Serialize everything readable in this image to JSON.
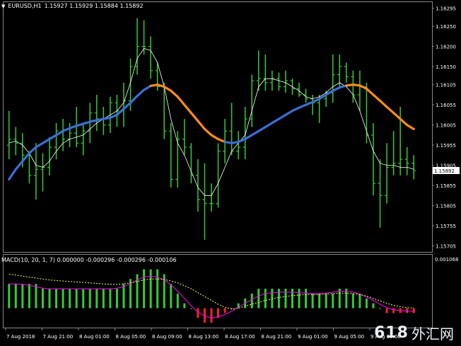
{
  "header": {
    "symbol": "EURUSD,H1",
    "ohlc": "1.15927 1.15929 1.15884 1.15892"
  },
  "price_axis": {
    "ticks": [
      "1.16295",
      "1.16250",
      "1.16200",
      "1.16150",
      "1.16105",
      "1.16055",
      "1.16005",
      "1.15955",
      "1.15905",
      "1.15855",
      "1.15805",
      "1.15755",
      "1.15705"
    ],
    "current_price": "1.15892"
  },
  "macd": {
    "label": "MACD(10, 20, 1, 7) 0.000000 -0.000296 -0.000296 -0.000106",
    "top_tick": "0.001068"
  },
  "time_axis": {
    "labels": [
      "7 Aug 2018",
      "7 Aug 21:00",
      "8 Aug 01:00",
      "8 Aug 05:00",
      "8 Aug 09:00",
      "8 Aug 13:00",
      "8 Aug 17:00",
      "8 Aug 21:00",
      "9 Aug 01:00",
      "9 Aug 05:00",
      "9 Aug 09:00"
    ]
  },
  "watermark": {
    "number": "618",
    "text": "外汇网"
  },
  "colors": {
    "bars": "#33cc33",
    "ma_up": "#3b6fd6",
    "ma_down": "#ff8c1a",
    "macd_signal": "#ff00ff",
    "macd_yellow": "#ffff66",
    "macd_neg": "#ff2222",
    "price_label_bg": "#ffffff"
  },
  "chart_data": {
    "type": "ohlc",
    "bars": [
      {
        "o": 1.15955,
        "h": 1.1604,
        "l": 1.1592,
        "c": 1.1597
      },
      {
        "o": 1.1597,
        "h": 1.16,
        "l": 1.1593,
        "c": 1.1596
      },
      {
        "o": 1.1596,
        "h": 1.15985,
        "l": 1.159,
        "c": 1.1593
      },
      {
        "o": 1.1593,
        "h": 1.1594,
        "l": 1.1586,
        "c": 1.1588
      },
      {
        "o": 1.1588,
        "h": 1.1596,
        "l": 1.1582,
        "c": 1.15895
      },
      {
        "o": 1.15895,
        "h": 1.15935,
        "l": 1.1584,
        "c": 1.159
      },
      {
        "o": 1.159,
        "h": 1.15975,
        "l": 1.1588,
        "c": 1.1595
      },
      {
        "o": 1.1595,
        "h": 1.1601,
        "l": 1.1592,
        "c": 1.1599
      },
      {
        "o": 1.1599,
        "h": 1.1602,
        "l": 1.1594,
        "c": 1.1597
      },
      {
        "o": 1.1597,
        "h": 1.1601,
        "l": 1.1595,
        "c": 1.15985
      },
      {
        "o": 1.15985,
        "h": 1.1605,
        "l": 1.1595,
        "c": 1.1596
      },
      {
        "o": 1.1596,
        "h": 1.1601,
        "l": 1.1593,
        "c": 1.1599
      },
      {
        "o": 1.1599,
        "h": 1.1606,
        "l": 1.1596,
        "c": 1.16035
      },
      {
        "o": 1.16035,
        "h": 1.1608,
        "l": 1.1599,
        "c": 1.1602
      },
      {
        "o": 1.1602,
        "h": 1.1605,
        "l": 1.1598,
        "c": 1.16005
      },
      {
        "o": 1.16005,
        "h": 1.16075,
        "l": 1.15985,
        "c": 1.1606
      },
      {
        "o": 1.1606,
        "h": 1.1608,
        "l": 1.16,
        "c": 1.1604
      },
      {
        "o": 1.1604,
        "h": 1.1611,
        "l": 1.16,
        "c": 1.16065
      },
      {
        "o": 1.16065,
        "h": 1.1617,
        "l": 1.1604,
        "c": 1.1615
      },
      {
        "o": 1.1615,
        "h": 1.1627,
        "l": 1.1613,
        "c": 1.162
      },
      {
        "o": 1.162,
        "h": 1.16265,
        "l": 1.1618,
        "c": 1.162
      },
      {
        "o": 1.162,
        "h": 1.16225,
        "l": 1.1612,
        "c": 1.1614
      },
      {
        "o": 1.1614,
        "h": 1.1616,
        "l": 1.1609,
        "c": 1.161
      },
      {
        "o": 1.161,
        "h": 1.1611,
        "l": 1.1597,
        "c": 1.1599
      },
      {
        "o": 1.1599,
        "h": 1.1601,
        "l": 1.1585,
        "c": 1.1587
      },
      {
        "o": 1.1587,
        "h": 1.1599,
        "l": 1.1585,
        "c": 1.1597
      },
      {
        "o": 1.1597,
        "h": 1.1602,
        "l": 1.1593,
        "c": 1.1595
      },
      {
        "o": 1.1595,
        "h": 1.1596,
        "l": 1.1586,
        "c": 1.1588
      },
      {
        "o": 1.1588,
        "h": 1.1592,
        "l": 1.1579,
        "c": 1.1582
      },
      {
        "o": 1.1582,
        "h": 1.1591,
        "l": 1.1572,
        "c": 1.1581
      },
      {
        "o": 1.1581,
        "h": 1.1586,
        "l": 1.1579,
        "c": 1.1581
      },
      {
        "o": 1.1581,
        "h": 1.1596,
        "l": 1.158,
        "c": 1.1594
      },
      {
        "o": 1.1594,
        "h": 1.1602,
        "l": 1.1591,
        "c": 1.1599
      },
      {
        "o": 1.1599,
        "h": 1.1606,
        "l": 1.1593,
        "c": 1.1594
      },
      {
        "o": 1.1594,
        "h": 1.1599,
        "l": 1.1592,
        "c": 1.1595
      },
      {
        "o": 1.1595,
        "h": 1.1605,
        "l": 1.1592,
        "c": 1.1602
      },
      {
        "o": 1.1602,
        "h": 1.1613,
        "l": 1.16,
        "c": 1.16115
      },
      {
        "o": 1.16115,
        "h": 1.1619,
        "l": 1.1609,
        "c": 1.1612
      },
      {
        "o": 1.1612,
        "h": 1.1618,
        "l": 1.1609,
        "c": 1.1611
      },
      {
        "o": 1.1611,
        "h": 1.1614,
        "l": 1.1609,
        "c": 1.1612
      },
      {
        "o": 1.1612,
        "h": 1.16135,
        "l": 1.1609,
        "c": 1.161
      },
      {
        "o": 1.161,
        "h": 1.1614,
        "l": 1.16085,
        "c": 1.16115
      },
      {
        "o": 1.16115,
        "h": 1.1612,
        "l": 1.1608,
        "c": 1.16095
      },
      {
        "o": 1.16095,
        "h": 1.1611,
        "l": 1.16075,
        "c": 1.1608
      },
      {
        "o": 1.1608,
        "h": 1.16095,
        "l": 1.1606,
        "c": 1.1607
      },
      {
        "o": 1.1607,
        "h": 1.1608,
        "l": 1.1603,
        "c": 1.1606
      },
      {
        "o": 1.1606,
        "h": 1.1608,
        "l": 1.1601,
        "c": 1.1607
      },
      {
        "o": 1.1607,
        "h": 1.1609,
        "l": 1.1605,
        "c": 1.16085
      },
      {
        "o": 1.16085,
        "h": 1.1618,
        "l": 1.1606,
        "c": 1.1613
      },
      {
        "o": 1.1613,
        "h": 1.1618,
        "l": 1.161,
        "c": 1.1615
      },
      {
        "o": 1.1615,
        "h": 1.1616,
        "l": 1.1611,
        "c": 1.16125
      },
      {
        "o": 1.16125,
        "h": 1.1614,
        "l": 1.1606,
        "c": 1.1608
      },
      {
        "o": 1.1608,
        "h": 1.1614,
        "l": 1.1604,
        "c": 1.161
      },
      {
        "o": 1.161,
        "h": 1.1611,
        "l": 1.1596,
        "c": 1.1598
      },
      {
        "o": 1.1598,
        "h": 1.1601,
        "l": 1.1583,
        "c": 1.1586
      },
      {
        "o": 1.1586,
        "h": 1.1592,
        "l": 1.1575,
        "c": 1.1583
      },
      {
        "o": 1.1583,
        "h": 1.1596,
        "l": 1.1581,
        "c": 1.159
      },
      {
        "o": 1.159,
        "h": 1.1599,
        "l": 1.1588,
        "c": 1.1591
      },
      {
        "o": 1.1591,
        "h": 1.1605,
        "l": 1.1588,
        "c": 1.1592
      },
      {
        "o": 1.1592,
        "h": 1.1595,
        "l": 1.1588,
        "c": 1.1591
      },
      {
        "o": 1.1591,
        "h": 1.1593,
        "l": 1.1587,
        "c": 1.15892
      }
    ],
    "thin_ma": [
      1.1596,
      1.15965,
      1.15955,
      1.15935,
      1.15905,
      1.159,
      1.15915,
      1.1594,
      1.1596,
      1.1597,
      1.15975,
      1.1598,
      1.15995,
      1.1601,
      1.1602,
      1.1603,
      1.1604,
      1.1606,
      1.1611,
      1.1617,
      1.16195,
      1.1619,
      1.1616,
      1.161,
      1.1602,
      1.1596,
      1.1593,
      1.1589,
      1.1585,
      1.1583,
      1.1583,
      1.1586,
      1.159,
      1.1594,
      1.1596,
      1.1598,
      1.1604,
      1.161,
      1.1612,
      1.1612,
      1.16115,
      1.1611,
      1.161,
      1.1609,
      1.16075,
      1.1607,
      1.16075,
      1.16085,
      1.161,
      1.1611,
      1.161,
      1.1608,
      1.1604,
      1.1599,
      1.1594,
      1.1591,
      1.15905,
      1.15905,
      1.159,
      1.159,
      1.15895
    ],
    "trend_ma": [
      1.1587,
      1.15895,
      1.15915,
      1.15935,
      1.1595,
      1.1596,
      1.1597,
      1.1598,
      1.1599,
      1.15997,
      1.16003,
      1.16008,
      1.16013,
      1.16017,
      1.1602,
      1.16023,
      1.1603,
      1.16045,
      1.1606,
      1.16077,
      1.16092,
      1.16102,
      1.16105,
      1.161,
      1.1609,
      1.16075,
      1.16055,
      1.16035,
      1.16015,
      1.15995,
      1.1598,
      1.1597,
      1.15963,
      1.1596,
      1.15963,
      1.1597,
      1.1598,
      1.1599,
      1.16,
      1.1601,
      1.1602,
      1.1603,
      1.1604,
      1.16048,
      1.16055,
      1.16062,
      1.1607,
      1.1608,
      1.1609,
      1.16098,
      1.16103,
      1.16105,
      1.16103,
      1.16095,
      1.1608,
      1.16065,
      1.1605,
      1.16035,
      1.1602,
      1.16005,
      1.15995
    ],
    "trend_dir": [
      "u",
      "u",
      "u",
      "u",
      "u",
      "u",
      "u",
      "u",
      "u",
      "u",
      "u",
      "u",
      "u",
      "u",
      "u",
      "u",
      "u",
      "u",
      "u",
      "u",
      "u",
      "u",
      "d",
      "d",
      "d",
      "d",
      "d",
      "d",
      "d",
      "d",
      "d",
      "d",
      "d",
      "u",
      "u",
      "u",
      "u",
      "u",
      "u",
      "u",
      "u",
      "u",
      "u",
      "u",
      "u",
      "u",
      "u",
      "u",
      "u",
      "u",
      "u",
      "d",
      "d",
      "d",
      "d",
      "d",
      "d",
      "d",
      "d",
      "d",
      "d"
    ],
    "macd_hist": [
      0.0005,
      0.0005,
      0.0005,
      0.0005,
      0.0005,
      0.0004,
      0.0004,
      0.0004,
      0.0004,
      0.0004,
      0.0004,
      0.0004,
      0.0004,
      0.0004,
      0.0004,
      0.0004,
      0.0004,
      0.0005,
      0.0006,
      0.0007,
      0.0008,
      0.0008,
      0.0008,
      0.0007,
      0.0005,
      0.0003,
      0.0001,
      0.0,
      -0.0002,
      -0.0003,
      -0.0003,
      -0.0002,
      -0.0001,
      0.0,
      0.0001,
      0.0002,
      0.0003,
      0.0004,
      0.0004,
      0.0004,
      0.0004,
      0.0004,
      0.0004,
      0.0004,
      0.0004,
      0.0003,
      0.0003,
      0.0003,
      0.0003,
      0.0004,
      0.0004,
      0.0003,
      0.0003,
      0.0002,
      0.0001,
      -0.0,
      -0.0001,
      -0.0001,
      -0.0001,
      -0.0001,
      -0.0001
    ],
    "macd_signal": [
      0.0005,
      0.0005,
      0.00049,
      0.00047,
      0.00044,
      0.00041,
      0.0004,
      0.0004,
      0.0004,
      0.0004,
      0.0004,
      0.0004,
      0.0004,
      0.0004,
      0.0004,
      0.0004,
      0.00041,
      0.00044,
      0.0005,
      0.00058,
      0.00064,
      0.00066,
      0.00064,
      0.00058,
      0.00048,
      0.00035,
      0.0002,
      5e-05,
      -8e-05,
      -0.00016,
      -0.0002,
      -0.00018,
      -0.00013,
      -6e-05,
      2e-05,
      0.0001,
      0.00018,
      0.00025,
      0.0003,
      0.00032,
      0.00033,
      0.00033,
      0.00033,
      0.00032,
      0.00031,
      0.0003,
      0.0003,
      0.00031,
      0.00033,
      0.00035,
      0.00035,
      0.00033,
      0.00029,
      0.00023,
      0.00016,
      8e-05,
      1e-05,
      -3e-05,
      -5e-05,
      -6e-05,
      -6e-05
    ],
    "macd_yellow": [
      0.0007,
      0.00068,
      0.00066,
      0.00064,
      0.00062,
      0.0006,
      0.00058,
      0.00057,
      0.00056,
      0.00055,
      0.00054,
      0.00053,
      0.00052,
      0.00051,
      0.0005,
      0.00049,
      0.00049,
      0.0005,
      0.00052,
      0.00055,
      0.00058,
      0.0006,
      0.0006,
      0.00059,
      0.00056,
      0.00052,
      0.00046,
      0.0004,
      0.00032,
      0.00024,
      0.00016,
      8e-05,
      2e-05,
      -2e-05,
      0.0,
      4e-05,
      8e-05,
      0.00012,
      0.00016,
      0.00019,
      0.00022,
      0.00024,
      0.00026,
      0.00027,
      0.00028,
      0.00028,
      0.00028,
      0.00029,
      0.0003,
      0.00031,
      0.00031,
      0.0003,
      0.00028,
      0.00025,
      0.0002,
      0.00015,
      0.0001,
      6e-05,
      3e-05,
      1e-05,
      0.0
    ],
    "price_range": [
      1.1569,
      1.1631
    ],
    "macd_range": [
      -0.0004,
      0.0011
    ]
  }
}
